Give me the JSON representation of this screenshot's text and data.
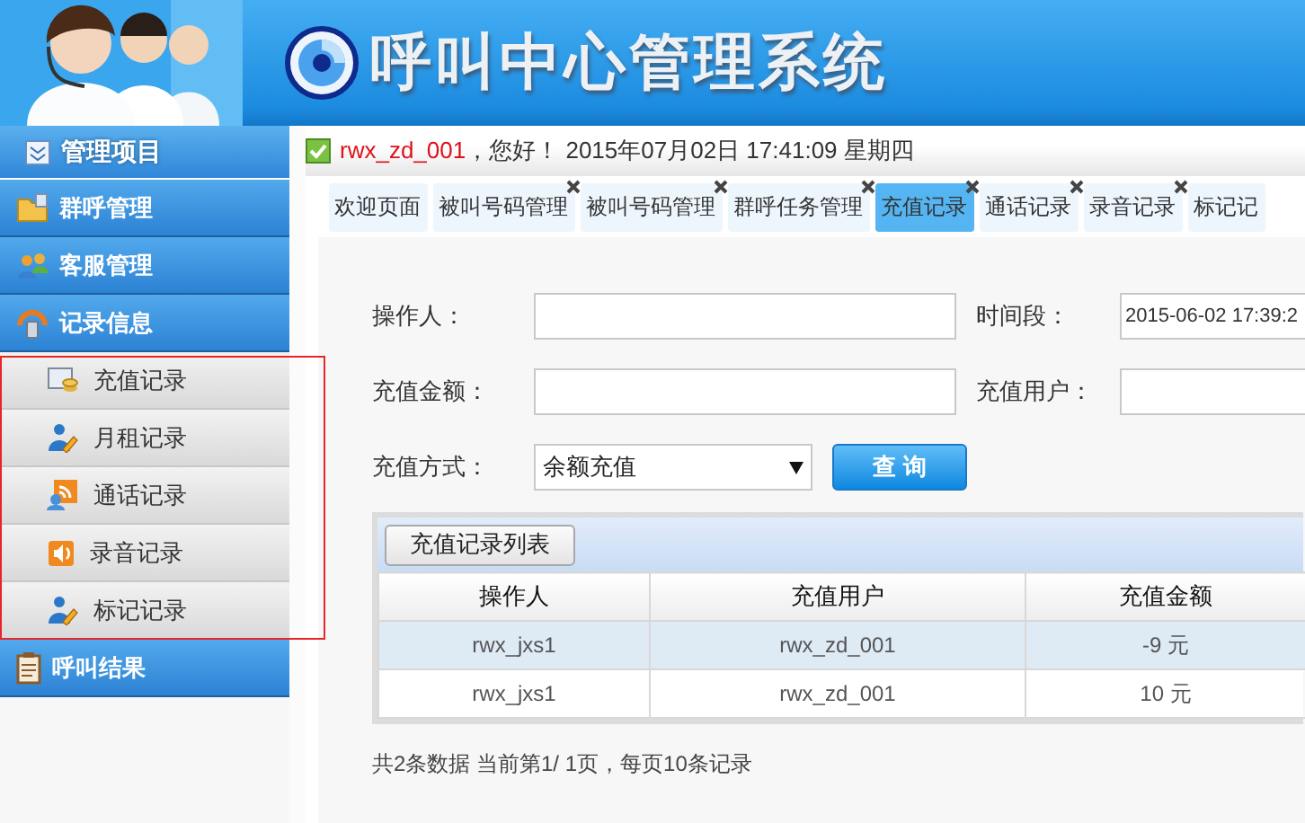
{
  "header": {
    "title": "呼叫中心管理系统"
  },
  "sidebar": {
    "title": "管理项目",
    "items": [
      {
        "label": "群呼管理",
        "highlighted": false
      },
      {
        "label": "客服管理",
        "highlighted": false
      },
      {
        "label": "记录信息",
        "highlighted": true,
        "children": [
          {
            "label": "充值记录"
          },
          {
            "label": "月租记录"
          },
          {
            "label": "通话记录"
          },
          {
            "label": "录音记录"
          },
          {
            "label": "标记记录"
          }
        ]
      },
      {
        "label": "呼叫结果",
        "highlighted": false
      }
    ]
  },
  "top_bar": {
    "user": "rwx_zd_001",
    "greeting": "，您好！",
    "datetime": "2015年07月02日 17:41:09 星期四"
  },
  "tabs": [
    {
      "label": "欢迎页面",
      "closable": false,
      "selected": false
    },
    {
      "label": "被叫号码管理",
      "closable": true,
      "selected": false
    },
    {
      "label": "被叫号码管理",
      "closable": true,
      "selected": false
    },
    {
      "label": "群呼任务管理",
      "closable": true,
      "selected": false
    },
    {
      "label": "充值记录",
      "closable": true,
      "selected": true
    },
    {
      "label": "通话记录",
      "closable": true,
      "selected": false
    },
    {
      "label": "录音记录",
      "closable": true,
      "selected": false
    },
    {
      "label": "标记记",
      "closable": false,
      "selected": false
    }
  ],
  "form": {
    "fields": [
      {
        "label": "操作人：",
        "kind": "text"
      },
      {
        "label": "时间段：",
        "kind": "text",
        "value": "2015-06-02 17:39:2"
      },
      {
        "label": "充值金额：",
        "kind": "text"
      },
      {
        "label": "充值用户：",
        "kind": "text"
      },
      {
        "label": "充值方式：",
        "kind": "select",
        "value": "余额充值"
      }
    ],
    "submit": "查 询"
  },
  "table": {
    "title_button": "充值记录列表",
    "columns": [
      "操作人",
      "充值用户",
      "充值金额"
    ],
    "rows": [
      {
        "cells": [
          "rwx_jxs1",
          "rwx_zd_001",
          "-9 元"
        ],
        "selected": true
      },
      {
        "cells": [
          "rwx_jxs1",
          "rwx_zd_001",
          "10 元"
        ],
        "selected": false
      }
    ]
  },
  "footer": "共2条数据 当前第1/ 1页，每页10条记录"
}
